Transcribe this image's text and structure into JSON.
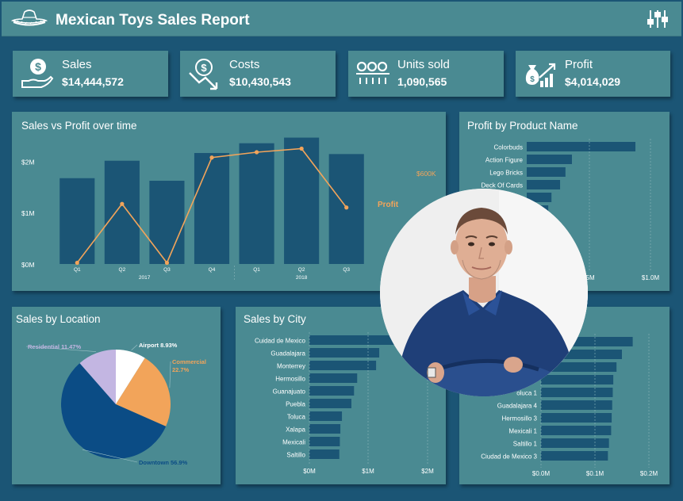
{
  "header": {
    "title": "Mexican Toys Sales Report",
    "hat_icon": "sombrero-icon",
    "filter_icon": "sliders-icon"
  },
  "kpis": [
    {
      "label": "Sales",
      "value": "$14,444,572",
      "icon": "money-hand-icon"
    },
    {
      "label": "Costs",
      "value": "$10,430,543",
      "icon": "dollar-down-icon"
    },
    {
      "label": "Units sold",
      "value": "1,090,565",
      "icon": "units-icon"
    },
    {
      "label": "Profit",
      "value": "$4,014,029",
      "icon": "moneybag-growth-icon"
    }
  ],
  "panels": {
    "sales_profit": "Sales vs Profit over time",
    "profit_product": "Profit by Product Name",
    "sales_location": "Sales by Location",
    "sales_city": "Sales by City"
  },
  "colors": {
    "bar": "#1b5575",
    "line": "#f2a45a",
    "panel": "#4a8a92",
    "background": "#1b5575"
  },
  "chart_data": [
    {
      "id": "sales_vs_profit",
      "type": "bar",
      "title": "Sales vs Profit over time",
      "categories": [
        "Q1",
        "Q2",
        "Q3",
        "Q4",
        "Q1",
        "Q2",
        "Q3"
      ],
      "groups": [
        {
          "label": "2017",
          "span": [
            0,
            3
          ]
        },
        {
          "label": "2018",
          "span": [
            4,
            6
          ]
        }
      ],
      "y_ticks": [
        "$0M",
        "$1M",
        "$2M"
      ],
      "ylim": [
        0,
        2500000
      ],
      "series": [
        {
          "name": "Sales",
          "type": "bar",
          "values": [
            1670000,
            2010000,
            1620000,
            2160000,
            2350000,
            2460000,
            2140000
          ]
        },
        {
          "name": "Profit",
          "type": "line",
          "axis": "right",
          "values": [
            20000,
            350000,
            20000,
            610000,
            640000,
            660000,
            330000
          ],
          "ylim": [
            0,
            720000
          ]
        }
      ],
      "right_tick": "$600K",
      "right_label": "Profit"
    },
    {
      "id": "profit_by_product",
      "type": "bar",
      "orientation": "horizontal",
      "title": "Profit by Product Name",
      "categories": [
        "Colorbuds",
        "Action Figure",
        "Lego Bricks",
        "Deck Of Cards",
        "",
        ""
      ],
      "values": [
        1010000,
        420000,
        360000,
        310000,
        230000,
        200000
      ],
      "x_ticks": [
        ".5M",
        "$1.0M"
      ],
      "xlim": [
        0,
        1150000
      ]
    },
    {
      "id": "sales_by_location",
      "type": "pie",
      "title": "Sales by Location",
      "labels": [
        "Airport 8.93%",
        "Commercial 22.7%",
        "Downtown 56.9%",
        "Residential 11.47%"
      ],
      "values": [
        8.93,
        22.7,
        56.9,
        11.47
      ],
      "colors": [
        "#ffffff",
        "#f2a45a",
        "#0b4c85",
        "#c3b6e2"
      ]
    },
    {
      "id": "sales_by_city",
      "type": "bar",
      "orientation": "horizontal",
      "title": "Sales by City",
      "categories": [
        "Cuidad de Mexico",
        "Guadalajara",
        "Monterrey",
        "Hermosillo",
        "Guanajuato",
        "Puebla",
        "Toluca",
        "Xalapa",
        "Mexicali",
        "Saltillo"
      ],
      "values": [
        2250000,
        1330000,
        1270000,
        910000,
        850000,
        800000,
        620000,
        590000,
        580000,
        570000
      ],
      "x_ticks": [
        "$0M",
        "$1M",
        "$2M"
      ],
      "xlim": [
        0,
        2250000
      ]
    },
    {
      "id": "profit_by_store",
      "type": "bar",
      "orientation": "horizontal",
      "categories": [
        "",
        "",
        "",
        "",
        "oluca 1",
        "Guadalajara 4",
        "Hermosillo 3",
        "Mexicali 1",
        "Saltillo 1",
        "Ciudad de Mexico 3"
      ],
      "values": [
        170000,
        150000,
        140000,
        134000,
        133000,
        132000,
        131000,
        130000,
        126000,
        124000
      ],
      "x_ticks": [
        "$0.0M",
        "$0.1M",
        "$0.2M"
      ],
      "xlim": [
        0,
        200000
      ]
    }
  ]
}
